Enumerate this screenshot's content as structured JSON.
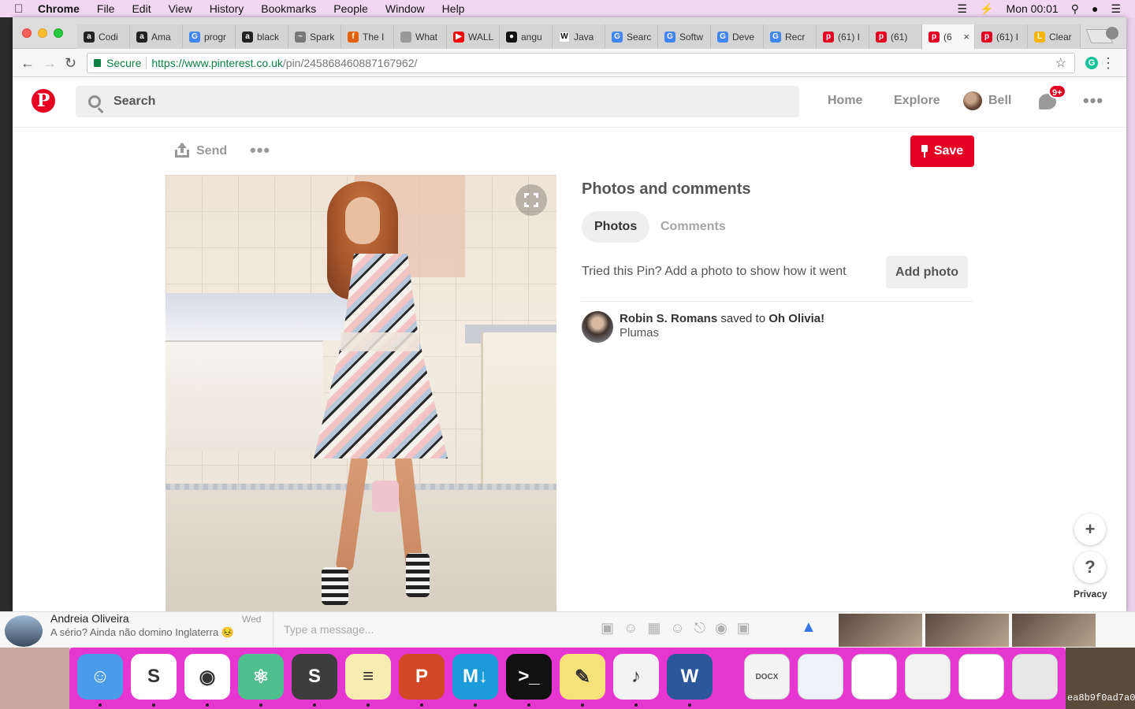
{
  "menubar": {
    "app": "Chrome",
    "items": [
      "File",
      "Edit",
      "View",
      "History",
      "Bookmarks",
      "People",
      "Window",
      "Help"
    ],
    "clock": "Mon 00:01"
  },
  "tabs": [
    {
      "favicon": "amazon-icon",
      "title": "Codi",
      "color": "#222222",
      "glyph": "a"
    },
    {
      "favicon": "amazon-icon",
      "title": "Ama",
      "color": "#222222",
      "glyph": "a"
    },
    {
      "favicon": "google-icon",
      "title": "progr",
      "color": "#4285f4",
      "glyph": "G"
    },
    {
      "favicon": "amazon-icon",
      "title": "black",
      "color": "#222222",
      "glyph": "a"
    },
    {
      "favicon": "spark-icon",
      "title": "Spark",
      "color": "#777777",
      "glyph": "~"
    },
    {
      "favicon": "firefox-icon",
      "title": "The I",
      "color": "#e66000",
      "glyph": "f"
    },
    {
      "favicon": "document-icon",
      "title": "What",
      "color": "#999999",
      "glyph": ""
    },
    {
      "favicon": "youtube-icon",
      "title": "WALL",
      "color": "#ff0000",
      "glyph": "▶"
    },
    {
      "favicon": "github-icon",
      "title": "angu",
      "color": "#111111",
      "glyph": "●"
    },
    {
      "favicon": "wikipedia-icon",
      "title": "Java",
      "color": "#ffffff",
      "glyph": "W"
    },
    {
      "favicon": "google-icon",
      "title": "Searc",
      "color": "#4285f4",
      "glyph": "G"
    },
    {
      "favicon": "google-icon",
      "title": "Softw",
      "color": "#4285f4",
      "glyph": "G"
    },
    {
      "favicon": "google-icon",
      "title": "Deve",
      "color": "#4285f4",
      "glyph": "G"
    },
    {
      "favicon": "google-icon",
      "title": "Recr",
      "color": "#4285f4",
      "glyph": "G"
    },
    {
      "favicon": "pinterest-icon",
      "title": "(61) I",
      "color": "#e60023",
      "glyph": "p"
    },
    {
      "favicon": "pinterest-icon",
      "title": "(61)",
      "color": "#e60023",
      "glyph": "p"
    },
    {
      "favicon": "pinterest-icon",
      "title": "(6",
      "color": "#e60023",
      "glyph": "p",
      "active": true
    },
    {
      "favicon": "pinterest-icon",
      "title": "(61) I",
      "color": "#e60023",
      "glyph": "p"
    },
    {
      "favicon": "letter-l-icon",
      "title": "Clear",
      "color": "#f4b400",
      "glyph": "L"
    }
  ],
  "omnibox": {
    "secure_label": "Secure",
    "url_host": "https://www.pinterest.co.uk",
    "url_path": "/pin/245868460887167962/"
  },
  "pinterest": {
    "search_placeholder": "Search",
    "nav": {
      "home": "Home",
      "explore": "Explore",
      "user": "Bell"
    },
    "notification_badge": "9+",
    "pin_actions": {
      "send": "Send",
      "save": "Save"
    },
    "photos_comments": {
      "title": "Photos and comments",
      "tab_photos": "Photos",
      "tab_comments": "Comments",
      "tried_text": "Tried this Pin? Add a photo to show how it went",
      "add_photo": "Add photo"
    },
    "saver": {
      "name": "Robin S. Romans",
      "action": "saved to",
      "board": "Oh Olivia!",
      "description": "Plumas"
    },
    "floating": {
      "plus": "+",
      "help": "?",
      "privacy": "Privacy"
    }
  },
  "messenger": {
    "contact": "Andreia Oliveira",
    "snippet": "A sério? Ainda não domino Inglaterra",
    "day": "Wed",
    "input_placeholder": "Type a message..."
  },
  "dock": {
    "apps": [
      {
        "name": "finder-icon",
        "color": "#4a9be8",
        "glyph": "☺"
      },
      {
        "name": "slack-icon",
        "color": "#ffffff",
        "glyph": "S"
      },
      {
        "name": "chrome-icon",
        "color": "#ffffff",
        "glyph": "◉"
      },
      {
        "name": "atom-icon",
        "color": "#4fbf8e",
        "glyph": "⚛"
      },
      {
        "name": "sublime-text-icon",
        "color": "#3d3d3d",
        "glyph": "S"
      },
      {
        "name": "notes-icon",
        "color": "#f9ecb0",
        "glyph": "≡"
      },
      {
        "name": "powerpoint-icon",
        "color": "#d24726",
        "glyph": "P"
      },
      {
        "name": "markdown-icon",
        "color": "#1a9ad6",
        "glyph": "M↓"
      },
      {
        "name": "terminal-icon",
        "color": "#111111",
        "glyph": ">_"
      },
      {
        "name": "stickies-icon",
        "color": "#f7e27a",
        "glyph": "✎"
      },
      {
        "name": "itunes-icon",
        "color": "#f3f3f3",
        "glyph": "♪"
      },
      {
        "name": "word-icon",
        "color": "#2b579a",
        "glyph": "W"
      }
    ],
    "docs": [
      {
        "name": "docx-file-icon",
        "color": "#f4f4f4",
        "glyph": "DOCX"
      },
      {
        "name": "word-window-icon",
        "color": "#eef2f8",
        "glyph": ""
      },
      {
        "name": "chrome-window-icon",
        "color": "#ffffff",
        "glyph": ""
      },
      {
        "name": "chrome-window-icon",
        "color": "#f2f2f2",
        "glyph": ""
      },
      {
        "name": "stickies-window-icon",
        "color": "#ffffff",
        "glyph": ""
      },
      {
        "name": "trash-icon",
        "color": "#e8e8e8",
        "glyph": ""
      }
    ],
    "hash": "ea8b9f0ad7a0"
  }
}
